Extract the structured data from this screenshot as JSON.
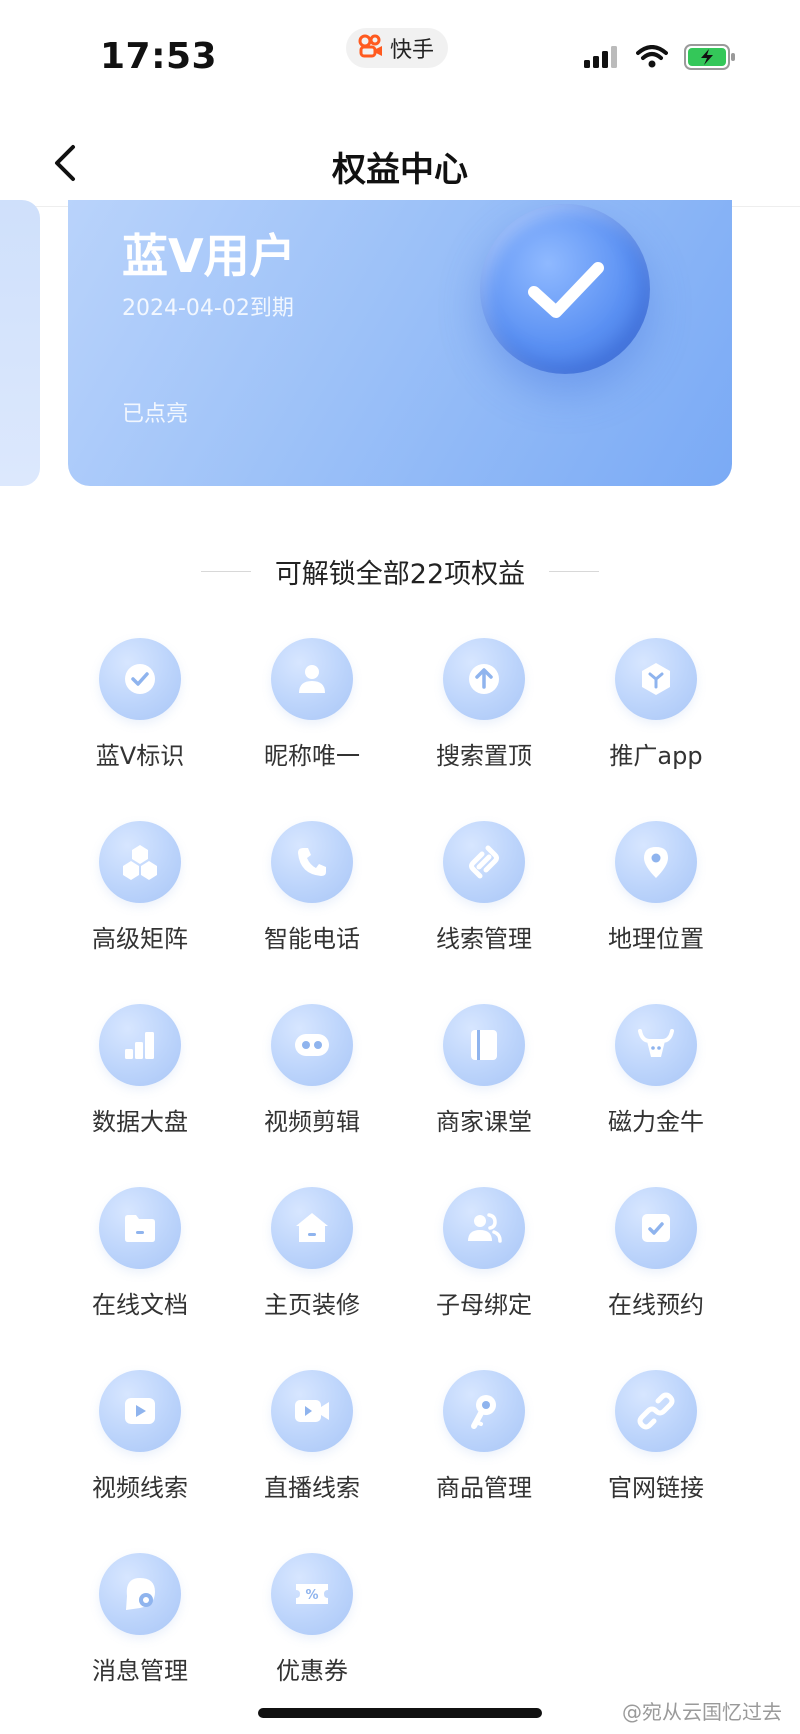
{
  "status_bar": {
    "time": "17:53",
    "app_name": "快手",
    "icons": [
      "signal-icon",
      "wifi-icon",
      "battery-charging-icon"
    ]
  },
  "nav": {
    "title": "权益中心",
    "back_icon": "chevron-left-icon"
  },
  "card": {
    "title": "蓝V用户",
    "expire": "2024-04-02到期",
    "status": "已点亮",
    "badge_icon": "check-badge-icon"
  },
  "section": {
    "heading": "可解锁全部22项权益"
  },
  "benefits": [
    {
      "label": "蓝V标识",
      "icon": "check-icon"
    },
    {
      "label": "昵称唯一",
      "icon": "user-icon"
    },
    {
      "label": "搜索置顶",
      "icon": "arrow-up-icon"
    },
    {
      "label": "推广app",
      "icon": "cube-icon"
    },
    {
      "label": "高级矩阵",
      "icon": "matrix-icon"
    },
    {
      "label": "智能电话",
      "icon": "phone-icon"
    },
    {
      "label": "线索管理",
      "icon": "link-s-icon"
    },
    {
      "label": "地理位置",
      "icon": "location-pin-icon"
    },
    {
      "label": "数据大盘",
      "icon": "bar-chart-icon"
    },
    {
      "label": "视频剪辑",
      "icon": "film-reel-icon"
    },
    {
      "label": "商家课堂",
      "icon": "book-icon"
    },
    {
      "label": "磁力金牛",
      "icon": "bull-icon"
    },
    {
      "label": "在线文档",
      "icon": "folder-icon"
    },
    {
      "label": "主页装修",
      "icon": "home-icon"
    },
    {
      "label": "子母绑定",
      "icon": "users-icon"
    },
    {
      "label": "在线预约",
      "icon": "calendar-check-icon"
    },
    {
      "label": "视频线索",
      "icon": "play-icon"
    },
    {
      "label": "直播线索",
      "icon": "video-camera-icon"
    },
    {
      "label": "商品管理",
      "icon": "key-icon"
    },
    {
      "label": "官网链接",
      "icon": "chain-link-icon"
    },
    {
      "label": "消息管理",
      "icon": "message-settings-icon"
    },
    {
      "label": "优惠券",
      "icon": "coupon-icon"
    }
  ],
  "watermark": "@宛从云国忆过去",
  "colors": {
    "card_start": "#b9d3fb",
    "card_end": "#7aaaf5",
    "icon_bg": "#bcd4fb",
    "icon_fg": "#ffffff",
    "icon_accent": "#8fb4ee"
  }
}
